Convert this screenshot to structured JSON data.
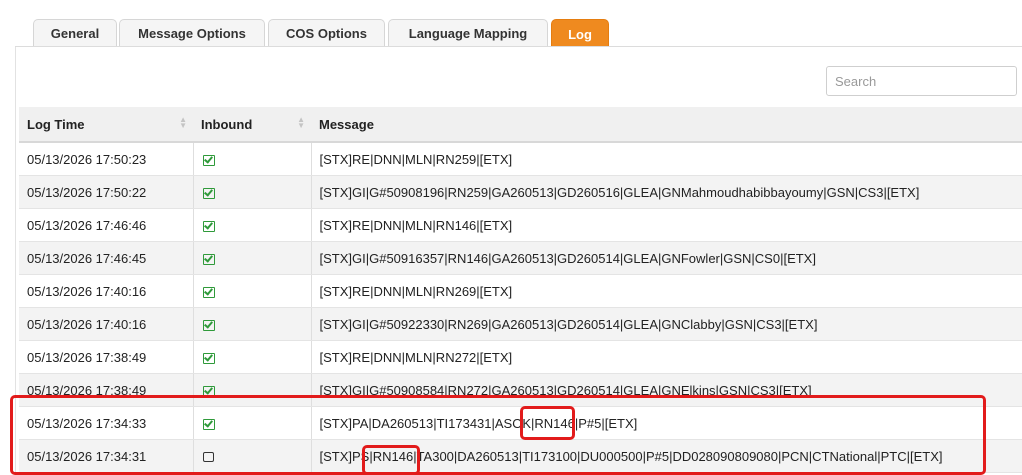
{
  "tabs": [
    {
      "label": "General"
    },
    {
      "label": "Message Options"
    },
    {
      "label": "COS Options"
    },
    {
      "label": "Language Mapping"
    },
    {
      "label": "Log",
      "active": true
    }
  ],
  "search": {
    "placeholder": "Search",
    "value": ""
  },
  "table": {
    "headers": {
      "log_time": "Log Time",
      "inbound": "Inbound",
      "message": "Message"
    },
    "rows": [
      {
        "time": "05/13/2026 17:50:23",
        "inbound": true,
        "message": "[STX]RE|DNN|MLN|RN259|[ETX]"
      },
      {
        "time": "05/13/2026 17:50:22",
        "inbound": true,
        "message": "[STX]GI|G#50908196|RN259|GA260513|GD260516|GLEA|GNMahmoudhabibbayoumy|GSN|CS3|[ETX]"
      },
      {
        "time": "05/13/2026 17:46:46",
        "inbound": true,
        "message": "[STX]RE|DNN|MLN|RN146|[ETX]"
      },
      {
        "time": "05/13/2026 17:46:45",
        "inbound": true,
        "message": "[STX]GI|G#50916357|RN146|GA260513|GD260514|GLEA|GNFowler|GSN|CS0|[ETX]"
      },
      {
        "time": "05/13/2026 17:40:16",
        "inbound": true,
        "message": "[STX]RE|DNN|MLN|RN269|[ETX]"
      },
      {
        "time": "05/13/2026 17:40:16",
        "inbound": true,
        "message": "[STX]GI|G#50922330|RN269|GA260513|GD260514|GLEA|GNClabby|GSN|CS3|[ETX]"
      },
      {
        "time": "05/13/2026 17:38:49",
        "inbound": true,
        "message": "[STX]RE|DNN|MLN|RN272|[ETX]"
      },
      {
        "time": "05/13/2026 17:38:49",
        "inbound": true,
        "message": "[STX]GI|G#50908584|RN272|GA260513|GD260514|GLEA|GNElkins|GSN|CS3|[ETX]"
      },
      {
        "time": "05/13/2026 17:34:33",
        "inbound": true,
        "message": "[STX]PA|DA260513|TI173431|ASOK|RN146|P#5|[ETX]"
      },
      {
        "time": "05/13/2026 17:34:31",
        "inbound": false,
        "message": "[STX]PS|RN146|TA300|DA260513|TI173100|DU000500|P#5|DD028090809080|PCN|CTNational|PTC|[ETX]"
      }
    ]
  },
  "colors": {
    "active_tab": "#ef8a1f",
    "inbound_check": "#2f9a3a",
    "highlight": "#e21b1b"
  }
}
